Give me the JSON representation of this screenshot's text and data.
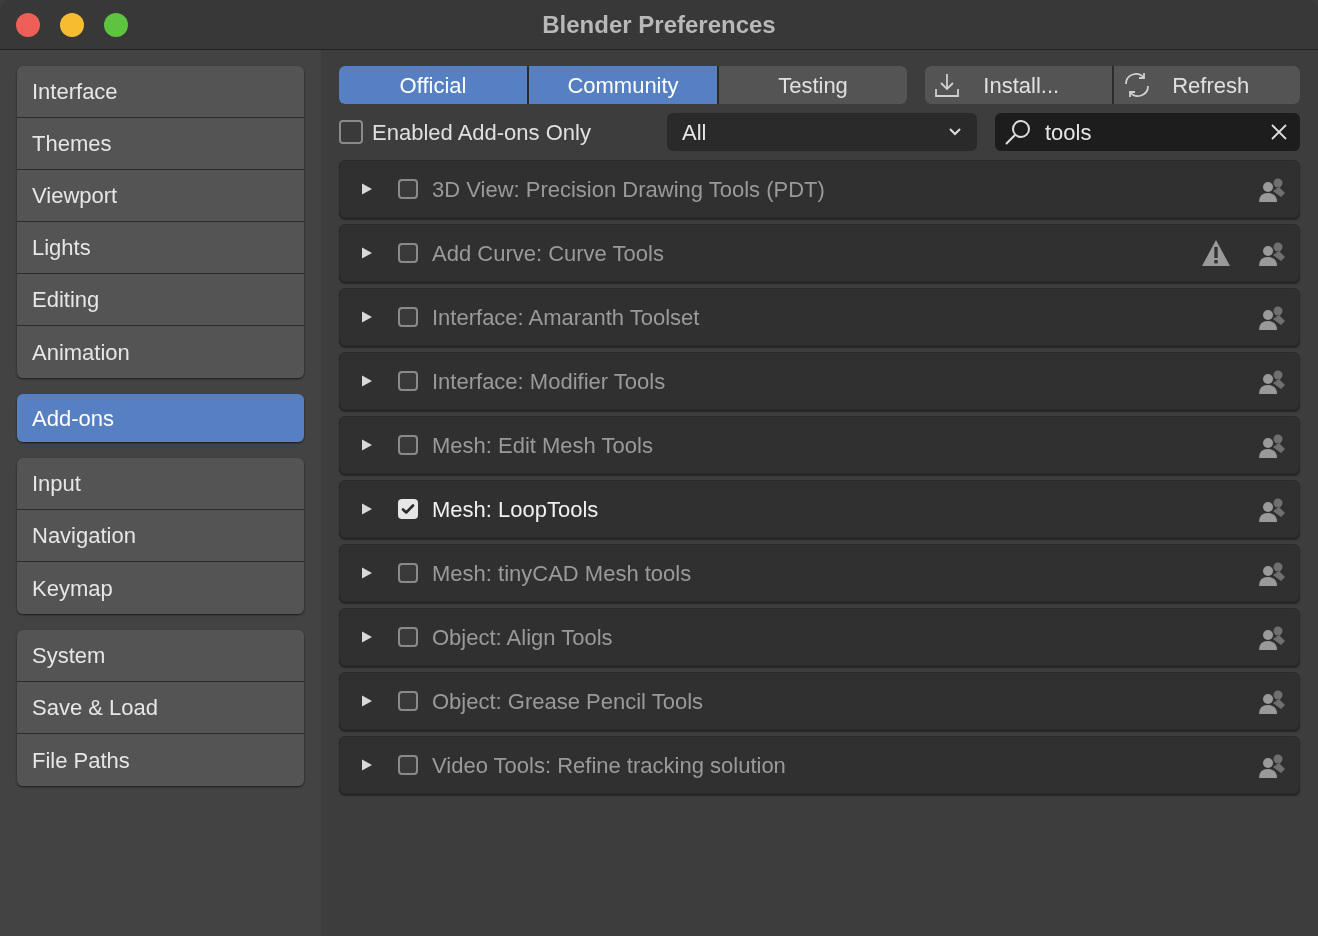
{
  "window": {
    "title": "Blender Preferences"
  },
  "sidebar": {
    "groups": [
      {
        "items": [
          {
            "label": "Interface",
            "selected": false
          },
          {
            "label": "Themes",
            "selected": false
          },
          {
            "label": "Viewport",
            "selected": false
          },
          {
            "label": "Lights",
            "selected": false
          },
          {
            "label": "Editing",
            "selected": false
          },
          {
            "label": "Animation",
            "selected": false
          }
        ]
      },
      {
        "items": [
          {
            "label": "Add-ons",
            "selected": true
          }
        ]
      },
      {
        "items": [
          {
            "label": "Input",
            "selected": false
          },
          {
            "label": "Navigation",
            "selected": false
          },
          {
            "label": "Keymap",
            "selected": false
          }
        ]
      },
      {
        "items": [
          {
            "label": "System",
            "selected": false
          },
          {
            "label": "Save & Load",
            "selected": false
          },
          {
            "label": "File Paths",
            "selected": false
          }
        ]
      }
    ]
  },
  "tabs": [
    {
      "label": "Official",
      "selected": true
    },
    {
      "label": "Community",
      "selected": true
    },
    {
      "label": "Testing",
      "selected": false
    }
  ],
  "actions": [
    {
      "label": "Install...",
      "kind": "install"
    },
    {
      "label": "Refresh",
      "kind": "refresh"
    }
  ],
  "filter": {
    "label": "Enabled Add-ons Only",
    "checked": false
  },
  "category": {
    "value": "All"
  },
  "search": {
    "value": "tools"
  },
  "addons": [
    {
      "name": "3D View: Precision Drawing Tools (PDT)",
      "enabled": false,
      "warning": false
    },
    {
      "name": "Add Curve: Curve Tools",
      "enabled": false,
      "warning": true
    },
    {
      "name": "Interface: Amaranth Toolset",
      "enabled": false,
      "warning": false
    },
    {
      "name": "Interface: Modifier Tools",
      "enabled": false,
      "warning": false
    },
    {
      "name": "Mesh: Edit Mesh Tools",
      "enabled": false,
      "warning": false
    },
    {
      "name": "Mesh: LoopTools",
      "enabled": true,
      "warning": false
    },
    {
      "name": "Mesh: tinyCAD Mesh tools",
      "enabled": false,
      "warning": false
    },
    {
      "name": "Object: Align Tools",
      "enabled": false,
      "warning": false
    },
    {
      "name": "Object: Grease Pencil Tools",
      "enabled": false,
      "warning": false
    },
    {
      "name": "Video Tools: Refine tracking solution",
      "enabled": false,
      "warning": false
    }
  ]
}
